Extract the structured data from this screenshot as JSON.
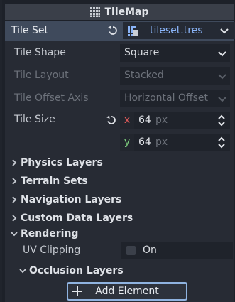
{
  "header": {
    "title": "TileMap",
    "icon": "tilemap-grid-icon"
  },
  "tileset": {
    "label": "Tile Set",
    "resource": "tileset.tres",
    "revert_icon": "revert-icon",
    "resource_icon": "tileset-resource-icon"
  },
  "properties": {
    "tile_shape": {
      "label": "Tile Shape",
      "value": "Square"
    },
    "tile_layout": {
      "label": "Tile Layout",
      "value": "Stacked"
    },
    "tile_offset_axis": {
      "label": "Tile Offset Axis",
      "value": "Horizontal Offset"
    },
    "tile_size": {
      "label": "Tile Size",
      "x_axis": "x",
      "x_value": "64",
      "y_axis": "y",
      "y_value": "64",
      "unit": "px"
    }
  },
  "sections": {
    "physics_layers": "Physics Layers",
    "terrain_sets": "Terrain Sets",
    "navigation_layers": "Navigation Layers",
    "custom_data_layers": "Custom Data Layers",
    "rendering": "Rendering",
    "occlusion_layers": "Occlusion Layers"
  },
  "rendering": {
    "uv_clipping": {
      "label": "UV Clipping",
      "value": "On"
    }
  },
  "add_element": {
    "label": "Add Element"
  },
  "colors": {
    "accent": "#8ab4f8",
    "x_axis": "#e05a5a",
    "y_axis": "#7fd07f"
  }
}
